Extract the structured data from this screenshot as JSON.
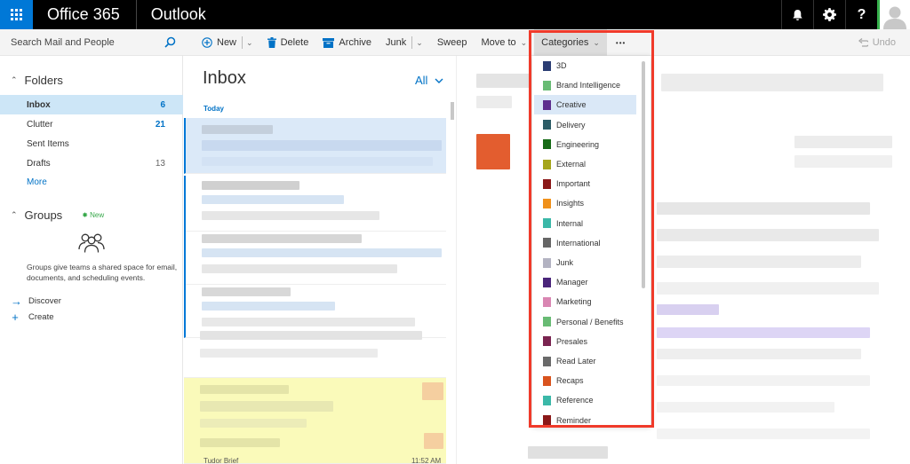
{
  "topbar": {
    "brand": "Office 365",
    "app": "Outlook",
    "icons": [
      "bell-icon",
      "gear-icon",
      "help-icon",
      "avatar"
    ],
    "help_glyph": "?"
  },
  "search": {
    "placeholder": "Search Mail and People"
  },
  "toolbar": {
    "new_label": "New",
    "delete_label": "Delete",
    "archive_label": "Archive",
    "junk_label": "Junk",
    "sweep_label": "Sweep",
    "move_label": "Move to",
    "categories_label": "Categories",
    "more_glyph": "•••",
    "undo_label": "Undo"
  },
  "nav": {
    "folders_label": "Folders",
    "folders": [
      {
        "label": "Inbox",
        "count": "6"
      },
      {
        "label": "Clutter",
        "count": "21"
      },
      {
        "label": "Sent Items",
        "count": ""
      },
      {
        "label": "Drafts",
        "count": "13"
      }
    ],
    "more_label": "More",
    "groups_label": "Groups",
    "groups_badge": "New",
    "groups_desc": "Groups give teams a shared space for email, documents, and scheduling events.",
    "discover_label": "Discover",
    "create_label": "Create"
  },
  "list": {
    "title": "Inbox",
    "filter_label": "All",
    "today_label": "Today",
    "partial_sender": "Tudor Brief",
    "partial_time": "11:52 AM"
  },
  "categories": [
    {
      "label": "3D",
      "color": "#2b3d73"
    },
    {
      "label": "Brand Intelligence",
      "color": "#68bb74"
    },
    {
      "label": "Creative",
      "color": "#5d2e8e"
    },
    {
      "label": "Delivery",
      "color": "#2c5c66"
    },
    {
      "label": "Engineering",
      "color": "#166a16"
    },
    {
      "label": "External",
      "color": "#a5a51a"
    },
    {
      "label": "Important",
      "color": "#8b1818"
    },
    {
      "label": "Insights",
      "color": "#f0901a"
    },
    {
      "label": "Internal",
      "color": "#3bb8a8"
    },
    {
      "label": "International",
      "color": "#666666"
    },
    {
      "label": "Junk",
      "color": "#b3b3c2"
    },
    {
      "label": "Manager",
      "color": "#4a257a"
    },
    {
      "label": "Marketing",
      "color": "#d986b2"
    },
    {
      "label": "Personal / Benefits",
      "color": "#68bb74"
    },
    {
      "label": "Presales",
      "color": "#7a2450"
    },
    {
      "label": "Read Later",
      "color": "#6a6a6a"
    },
    {
      "label": "Recaps",
      "color": "#d9531e"
    },
    {
      "label": "Reference",
      "color": "#3bb8a8"
    },
    {
      "label": "Reminder",
      "color": "#8b1818"
    }
  ],
  "categories_hover_index": 2
}
